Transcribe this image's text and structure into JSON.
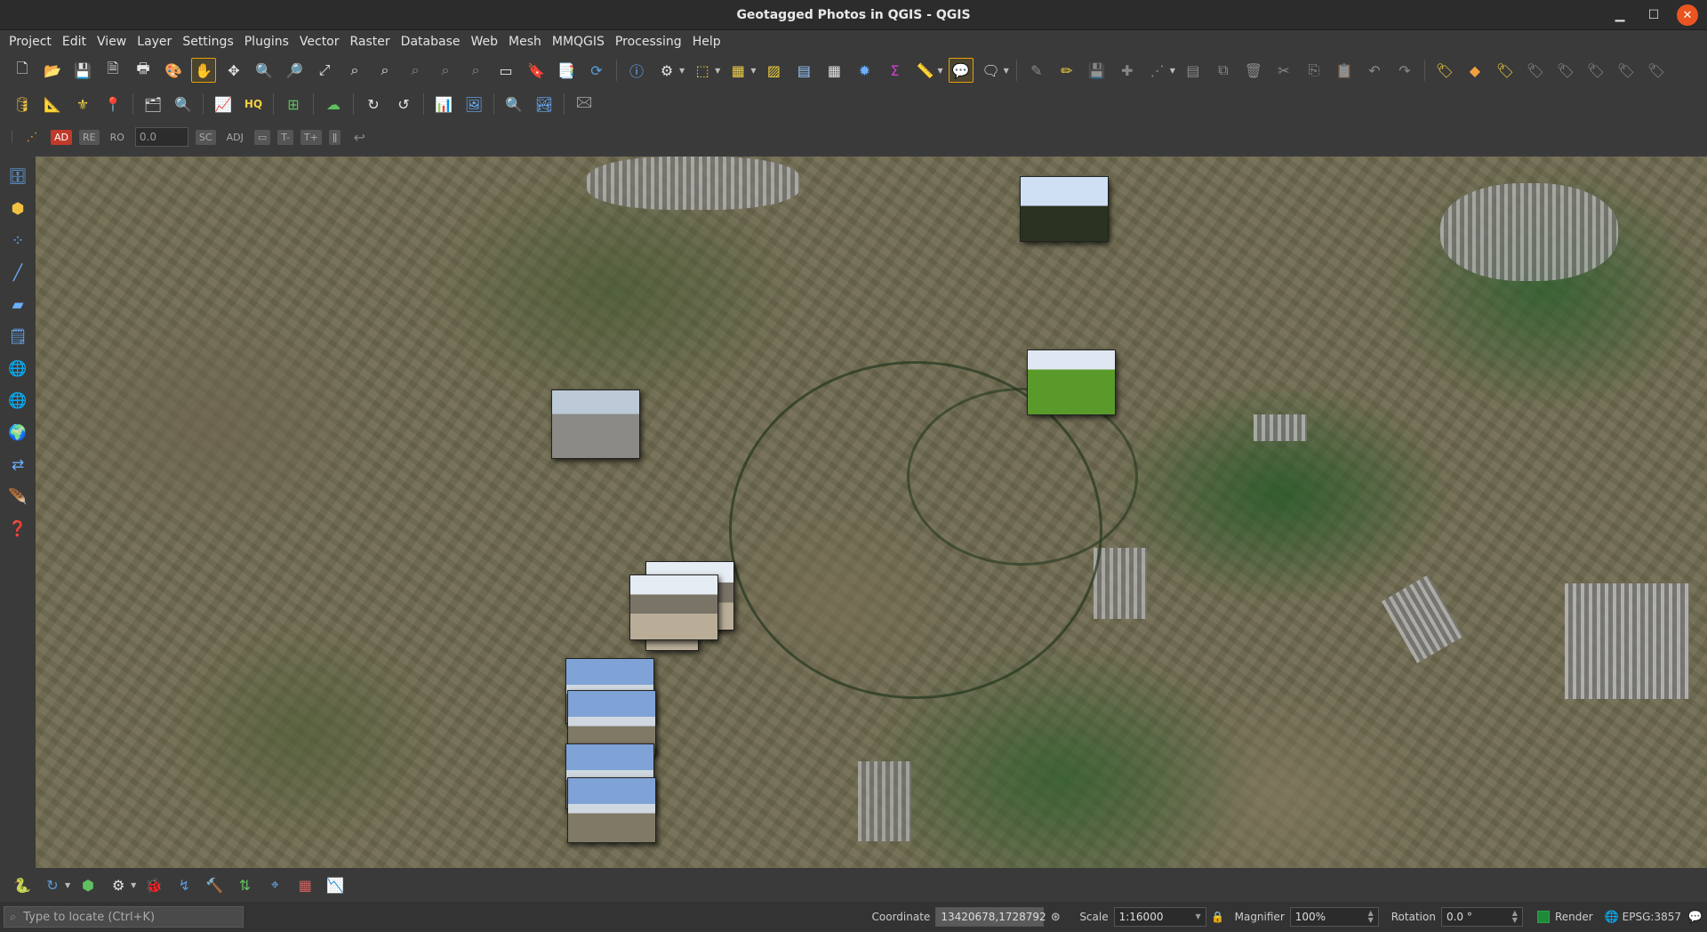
{
  "window": {
    "title": "Geotagged Photos in QGIS - QGIS"
  },
  "menu": [
    "Project",
    "Edit",
    "View",
    "Layer",
    "Settings",
    "Plugins",
    "Vector",
    "Raster",
    "Database",
    "Web",
    "Mesh",
    "MMQGIS",
    "Processing",
    "Help"
  ],
  "advanced_digitizing": {
    "ad": "AD",
    "rel": "RE",
    "ro": "RO",
    "value": "0.0",
    "sc": "SC",
    "adj": "ADJ",
    "tminus": "T-",
    "tplus": "T+"
  },
  "photos": [
    {
      "type": "field-trees"
    },
    {
      "type": "green-field"
    },
    {
      "type": "road-wall"
    },
    {
      "type": "dry-land"
    },
    {
      "type": "dry-land-2"
    },
    {
      "type": "clearing"
    },
    {
      "type": "landscape-1"
    },
    {
      "type": "landscape-2"
    },
    {
      "type": "landscape-3"
    },
    {
      "type": "landscape-4"
    }
  ],
  "status": {
    "locator_placeholder": "Type to locate (Ctrl+K)",
    "coordinate_label": "Coordinate",
    "coordinate_value": "13420678,1728792",
    "scale_label": "Scale",
    "scale_value": "1:16000",
    "magnifier_label": "Magnifier",
    "magnifier_value": "100%",
    "rotation_label": "Rotation",
    "rotation_value": "0.0 °",
    "render_label": "Render",
    "crs": "EPSG:3857"
  },
  "colors": {
    "accent": "#e95420",
    "render_check": "#1f8a3a",
    "selected_tool": "#e6a100"
  }
}
